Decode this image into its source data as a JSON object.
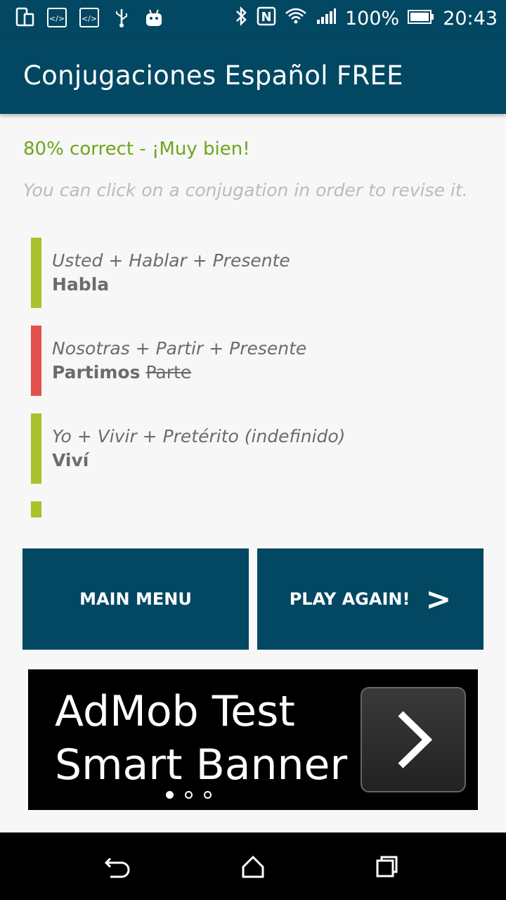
{
  "status_bar": {
    "battery": "100%",
    "time": "20:43"
  },
  "app": {
    "title": "Conjugaciones Español FREE"
  },
  "results": {
    "score_text": "80% correct - ¡Muy bien!",
    "hint": "You can click on a conjugation in order to revise it."
  },
  "conjugations": [
    {
      "prompt": "Usted + Hablar + Presente",
      "answer": "Habla",
      "wrong": "",
      "status": "correct"
    },
    {
      "prompt": "Nosotras + Partir + Presente",
      "answer": "Partimos",
      "wrong": "Parte",
      "status": "incorrect"
    },
    {
      "prompt": "Yo + Vivir + Pretérito (indefinido)",
      "answer": "Viví",
      "wrong": "",
      "status": "correct"
    },
    {
      "prompt": "",
      "answer": "",
      "wrong": "",
      "status": "correct"
    }
  ],
  "buttons": {
    "main_menu": "MAIN MENU",
    "play_again": "PLAY AGAIN!",
    "play_again_arrow": ">"
  },
  "ad": {
    "line1": "AdMob Test",
    "line2": "Smart Banner"
  },
  "colors": {
    "primary": "#034862",
    "correct": "#a7c22a",
    "incorrect": "#e4504c",
    "score": "#6fa51d"
  }
}
